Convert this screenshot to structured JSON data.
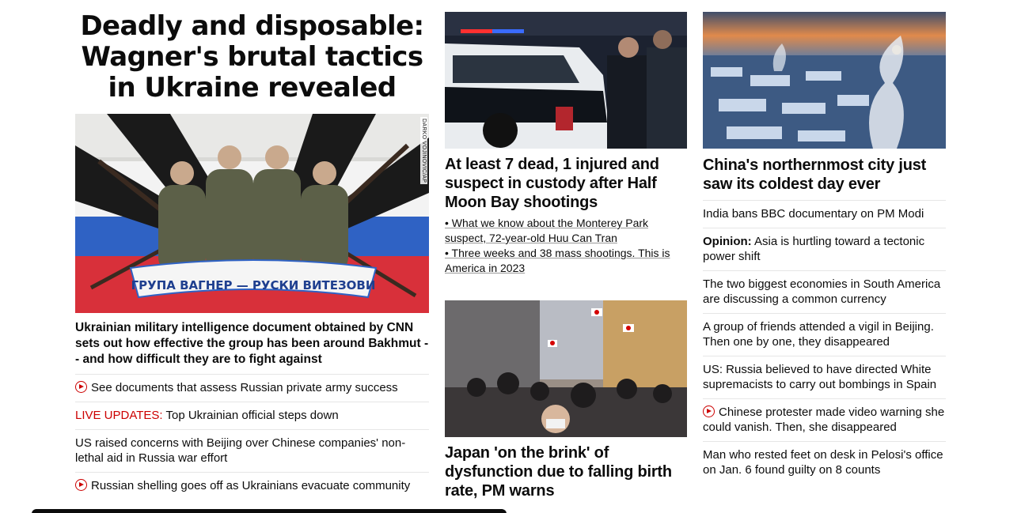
{
  "lead": {
    "headline": "Deadly and disposable: Wagner's brutal tactics in Ukraine revealed",
    "image_credit": "DARKO VOJINOVIC/AP",
    "mural_text": "ГРУПА ВАГНЕР — РУСКИ ВИТЕЗОВИ",
    "summary": "Ukrainian military intelligence document obtained by CNN sets out how effective the group has been around Bakhmut -- and how difficult they are to fight against",
    "links": [
      {
        "icon": "play-icon",
        "text": "See documents that assess Russian private army success"
      },
      {
        "prefix": "LIVE UPDATES:",
        "text": " Top Ukrainian official steps down"
      },
      {
        "text": "US raised concerns with Beijing over Chinese companies' non-lethal aid in Russia war effort"
      },
      {
        "icon": "play-icon",
        "text": "Russian shelling goes off as Ukrainians evacuate community"
      }
    ]
  },
  "middle": {
    "story1": {
      "title": "At least 7 dead, 1 injured and suspect in custody after Half Moon Bay shootings",
      "sublinks": [
        "• What we know about the Monterey Park suspect, 72-year-old Huu Can Tran",
        "• Three weeks and 38 mass shootings. This is America in 2023"
      ]
    },
    "story2": {
      "title": "Japan 'on the brink' of dysfunction due to falling birth rate, PM warns"
    }
  },
  "right": {
    "title": "China's northernmost city just saw its coldest day ever",
    "links": [
      {
        "text": "India bans BBC documentary on PM Modi"
      },
      {
        "prefix": "Opinion:",
        "text": " Asia is hurtling toward a tectonic power shift"
      },
      {
        "text": "The two biggest economies in South America are discussing a common currency"
      },
      {
        "text": "A group of friends attended a vigil in Beijing. Then one by one, they disappeared"
      },
      {
        "text": "US: Russia believed to have directed White supremacists to carry out bombings in Spain"
      },
      {
        "icon": "play-icon",
        "text": "Chinese protester made video warning she could vanish. Then, she disappeared"
      },
      {
        "text": "Man who rested feet on desk in Pelosi's office on Jan. 6 found guilty on 8 counts"
      }
    ]
  },
  "colors": {
    "accent_red": "#cc0000",
    "text": "#0c0c0c",
    "divider": "#e6e6e6"
  }
}
